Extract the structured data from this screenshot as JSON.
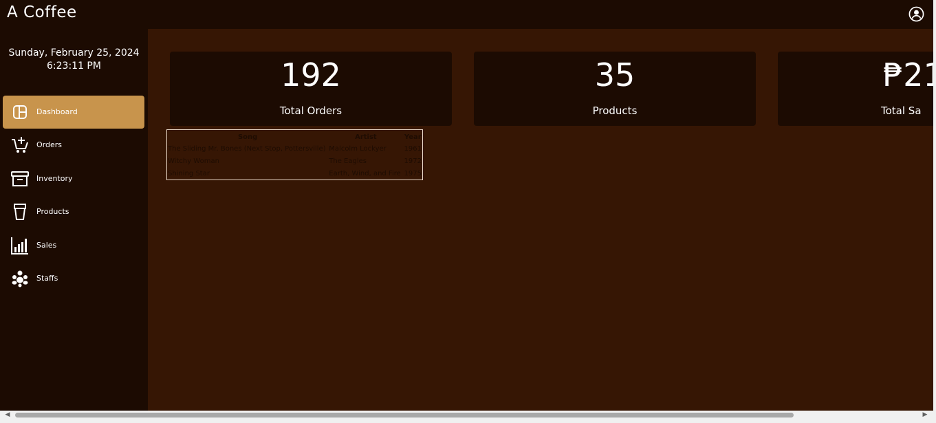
{
  "app": {
    "title": "A Coffee"
  },
  "sidebar": {
    "date": "Sunday, February 25, 2024",
    "time": "6:23:11 PM",
    "items": [
      {
        "label": "Dashboard",
        "icon": "dashboard-icon",
        "active": true
      },
      {
        "label": "Orders",
        "icon": "cart-add-icon",
        "active": false
      },
      {
        "label": "Inventory",
        "icon": "archive-box-icon",
        "active": false
      },
      {
        "label": "Products",
        "icon": "cup-icon",
        "active": false
      },
      {
        "label": "Sales",
        "icon": "bar-chart-icon",
        "active": false
      },
      {
        "label": "Staffs",
        "icon": "people-group-icon",
        "active": false
      }
    ]
  },
  "cards": [
    {
      "value": "192",
      "label": "Total Orders"
    },
    {
      "value": "35",
      "label": "Products"
    },
    {
      "value": "₱21",
      "label": "Total Sa"
    }
  ],
  "song_table": {
    "headers": [
      "Song",
      "Artist",
      "Year"
    ],
    "rows": [
      [
        "The Sliding Mr. Bones (Next Stop, Pottersville)",
        "Malcolm Lockyer",
        "1961"
      ],
      [
        "Witchy Woman",
        "The Eagles",
        "1972"
      ],
      [
        "Shining Star",
        "Earth, Wind, and Fire",
        "1975"
      ]
    ]
  },
  "colors": {
    "background": "#361604",
    "panel": "#1c0b02",
    "accent": "#c8944c",
    "text": "#ffffff"
  }
}
